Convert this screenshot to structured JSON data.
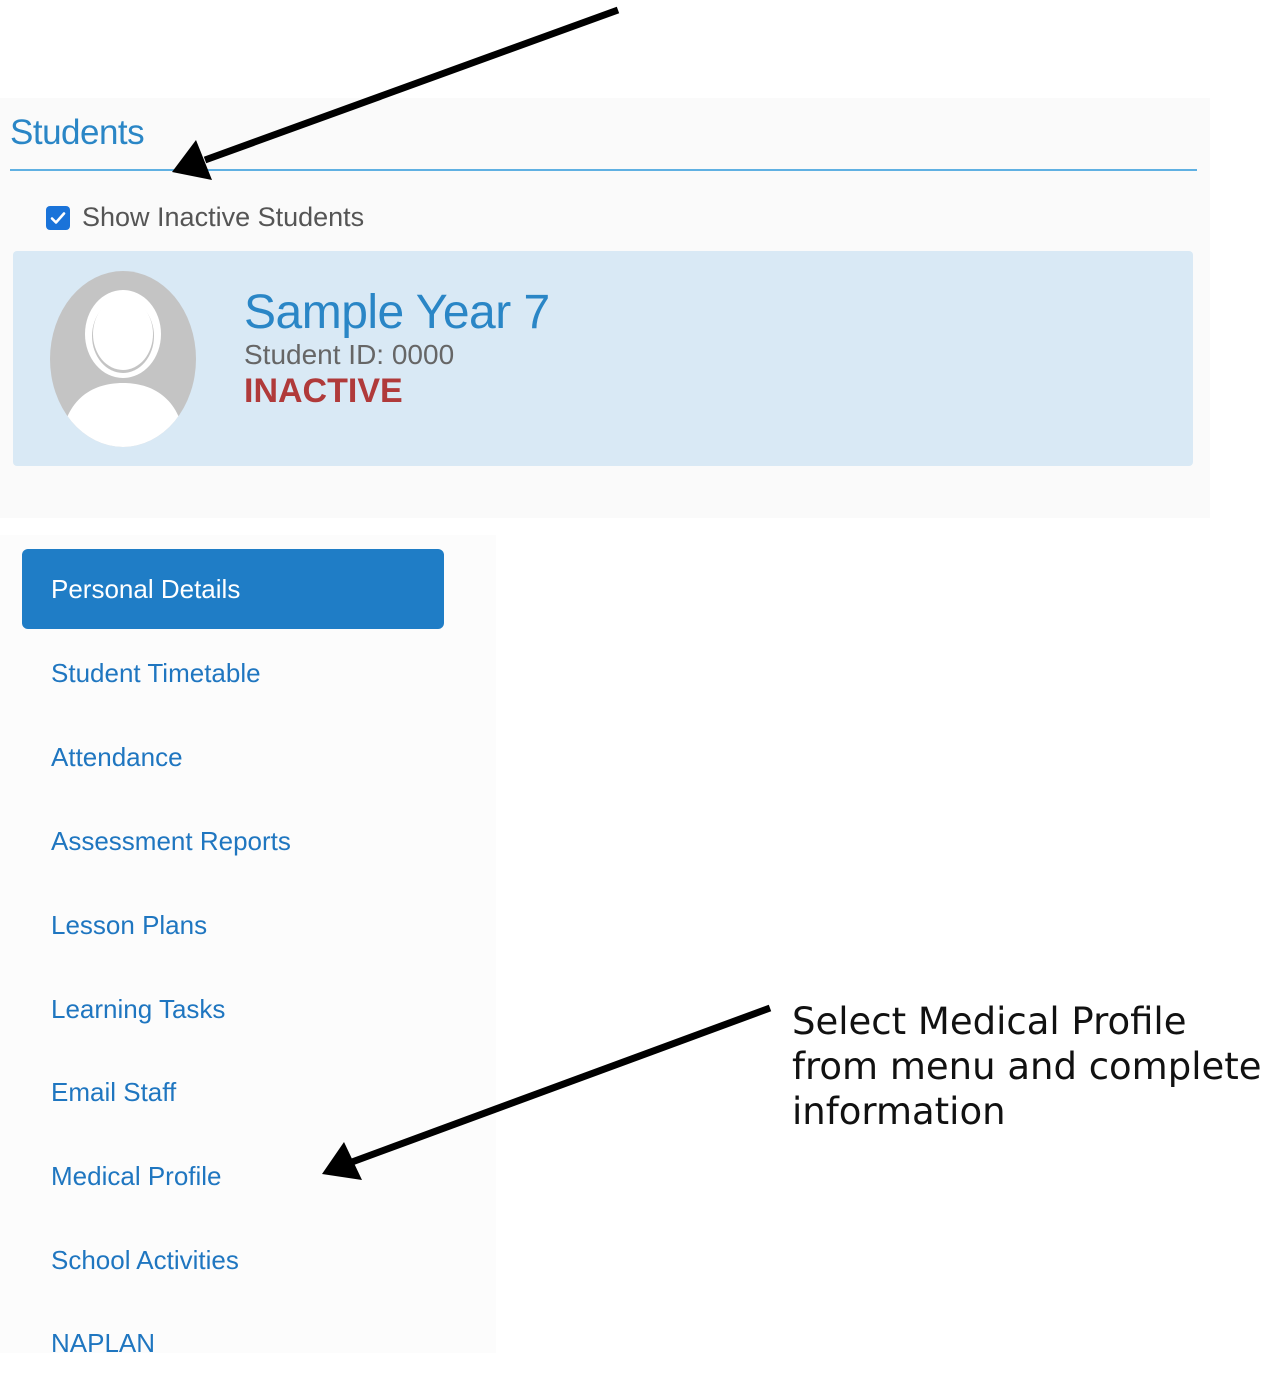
{
  "students_section": {
    "heading": "Students",
    "show_inactive_label": "Show Inactive Students",
    "show_inactive_checked": true
  },
  "student": {
    "name": "Sample Year 7",
    "student_id": "Student ID: 0000",
    "status": "INACTIVE"
  },
  "menu": {
    "items": [
      {
        "label": "Personal Details",
        "active": true
      },
      {
        "label": "Student Timetable",
        "active": false
      },
      {
        "label": "Attendance",
        "active": false
      },
      {
        "label": "Assessment Reports",
        "active": false
      },
      {
        "label": "Lesson Plans",
        "active": false
      },
      {
        "label": "Learning Tasks",
        "active": false
      },
      {
        "label": "Email Staff",
        "active": false
      },
      {
        "label": "Medical Profile",
        "active": false
      },
      {
        "label": "School Activities",
        "active": false
      },
      {
        "label": "NAPLAN",
        "active": false
      }
    ]
  },
  "annotation": {
    "line1": "Select Medical Profile",
    "line2": "from menu and complete",
    "line3": "information"
  },
  "colors": {
    "accent": "#2a86c6",
    "active_menu": "#1f7dc6",
    "card_bg": "#d9e9f5",
    "inactive_status": "#b03a3a"
  }
}
